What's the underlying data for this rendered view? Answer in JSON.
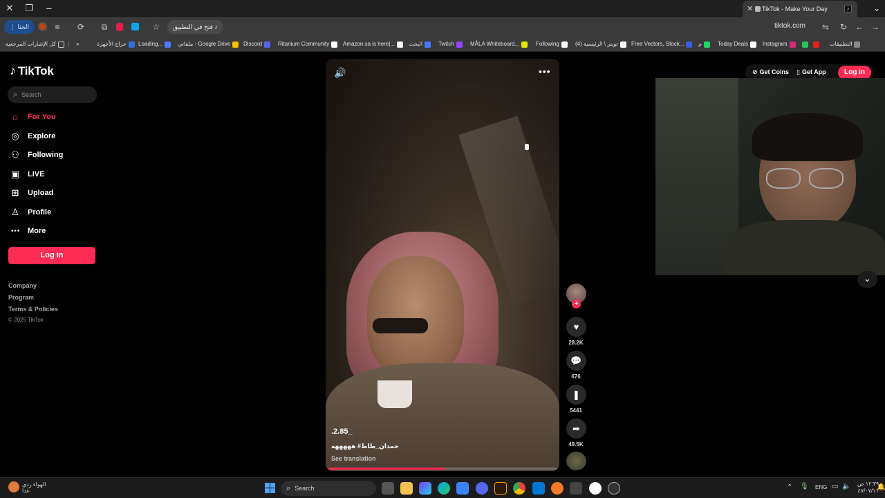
{
  "browser": {
    "tab_title": "TikTok - Make Your Day",
    "open_in_app_label": "فتح في التطبيق",
    "url": "tiktok.com",
    "profile_label": "الحثا",
    "bookmarks": [
      {
        "label": "التطبيقات",
        "color": "#888888"
      },
      {
        "label": "",
        "color": "#e62117"
      },
      {
        "label": "",
        "color": "#22c55e"
      },
      {
        "label": "Instagram",
        "color": "#d62976"
      },
      {
        "label": "Today Deals",
        "color": "#ffffff"
      },
      {
        "label": "م",
        "color": "#25d366"
      },
      {
        "label": "Free Vectors, Stock...",
        "color": "#3b5bdb"
      },
      {
        "label": "(4) تويتر \\ الرئيسية",
        "color": "#ffffff"
      },
      {
        "label": "Following",
        "color": "#ffffff"
      },
      {
        "label": "MÅLA Whiteboard...",
        "color": "#e6e600"
      },
      {
        "label": "Twitch",
        "color": "#9146ff"
      },
      {
        "label": "البحث",
        "color": "#4a7aff"
      },
      {
        "label": "Amazon.sa is here|...",
        "color": "#ffffff"
      },
      {
        "label": "Ritanium Community",
        "color": "#ffffff"
      },
      {
        "label": "Discord",
        "color": "#5865f2"
      },
      {
        "label": "ملفاتي - Google Drive",
        "color": "#fbbc04"
      },
      {
        "label": "Loading...",
        "color": "#4a7aff"
      },
      {
        "label": "حراج الأجهزة",
        "color": "#2f6fd6"
      }
    ],
    "all_bookmarks_label": "كل الإشارات المرجعية"
  },
  "tiktok": {
    "logo_text": "TikTok",
    "search_placeholder": "Search",
    "nav": [
      {
        "label": "For You",
        "icon": "home-icon",
        "active": true
      },
      {
        "label": "Explore",
        "icon": "compass-icon",
        "active": false
      },
      {
        "label": "Following",
        "icon": "following-icon",
        "active": false
      },
      {
        "label": "LIVE",
        "icon": "live-icon",
        "active": false
      },
      {
        "label": "Upload",
        "icon": "upload-icon",
        "active": false
      },
      {
        "label": "Profile",
        "icon": "profile-icon",
        "active": false
      },
      {
        "label": "More",
        "icon": "more-icon",
        "active": false
      }
    ],
    "login_label": "Log in",
    "footer": {
      "company": "Company",
      "program": "Program",
      "terms": "Terms & Policies",
      "copyright": "© 2025 TikTok"
    },
    "header": {
      "get_coins": "Get Coins",
      "get_app": "Get App",
      "login": "Log in"
    },
    "video": {
      "caption_top": ".2.85_",
      "hashtags": "حمدان_طاط# هههههه",
      "see_translation": "See translation",
      "progress": 0.51
    },
    "actions": {
      "likes": "28.2K",
      "comments": "676",
      "saves": "5441",
      "shares": "49.5K"
    },
    "accent_color": "#fe2c55"
  },
  "taskbar": {
    "weather_line1": "الهواء ردي",
    "weather_line2": "غدا",
    "search_placeholder": "Search",
    "language": "ENG",
    "time": "١٢:٣٩ ص",
    "date": "٤٧/٠٧/١١"
  }
}
